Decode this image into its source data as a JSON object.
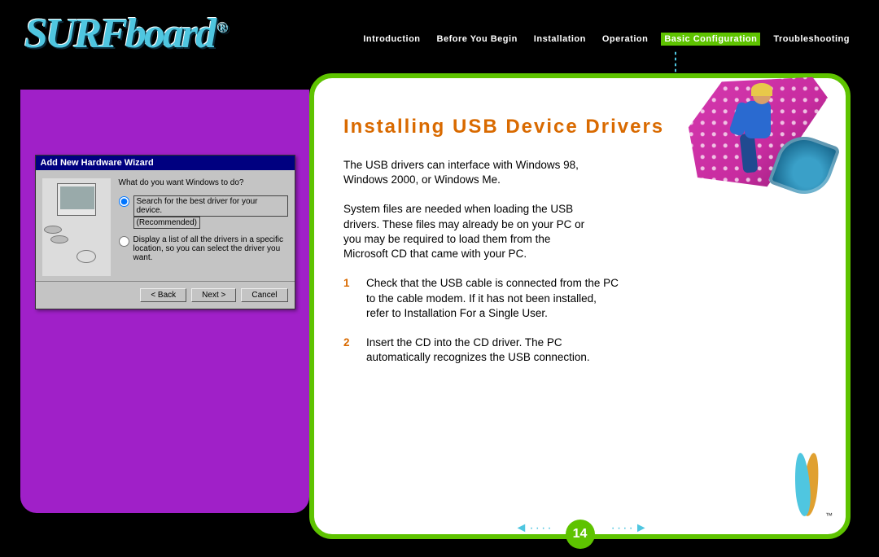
{
  "logo": {
    "text": "SURFboard",
    "reg": "®"
  },
  "nav": {
    "items": [
      {
        "label": "Introduction",
        "active": false
      },
      {
        "label": "Before You Begin",
        "active": false
      },
      {
        "label": "Installation",
        "active": false
      },
      {
        "label": "Operation",
        "active": false
      },
      {
        "label": "Basic Configuration",
        "active": true
      },
      {
        "label": "Troubleshooting",
        "active": false
      }
    ]
  },
  "wizard": {
    "title": "Add New Hardware Wizard",
    "question": "What do you want Windows to do?",
    "opt1_line1": "Search for the best driver for your device.",
    "opt1_line2": "(Recommended)",
    "opt2": "Display a list of all the drivers in a specific location, so you can select the driver you want.",
    "buttons": {
      "back": "< Back",
      "next": "Next >",
      "cancel": "Cancel"
    }
  },
  "main": {
    "heading": "Installing USB Device Drivers",
    "para1": "The USB drivers can interface with Windows 98, Windows 2000, or Windows Me.",
    "para2": "System files are needed when loading the USB drivers. These files may already be on your PC or you may be required to load them from the Microsoft CD that came with your PC.",
    "steps": [
      {
        "num": "1",
        "text": "Check that the USB cable is connected from the PC to the cable modem. If it has not been installed, refer to Installation For a Single User."
      },
      {
        "num": "2",
        "text": "Insert the CD into the CD driver. The PC automatically recognizes the USB connection."
      }
    ],
    "page_number": "14",
    "tm": "™"
  },
  "pager": {
    "prev_glyph": "◄····",
    "next_glyph": "····►"
  }
}
